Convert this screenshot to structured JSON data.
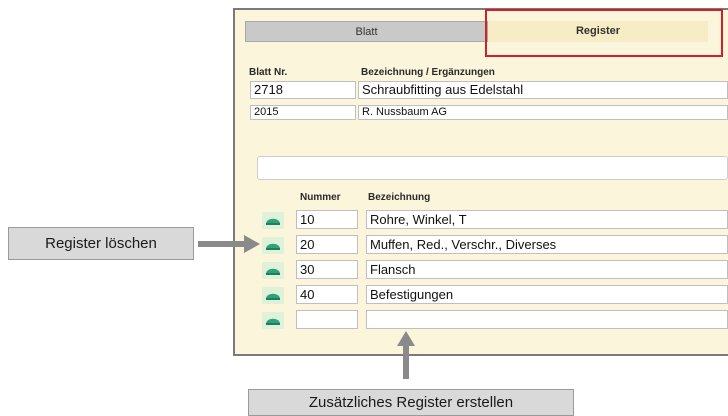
{
  "tabs": {
    "blatt": "Blatt",
    "register": "Register"
  },
  "header": {
    "blatt_nr_label": "Blatt Nr.",
    "bezeichnung_label": "Bezeichnung / Ergänzungen",
    "blatt_nr": "2718",
    "bezeichnung": "Schraubfitting aus Edelstahl",
    "year": "2015",
    "ergaenzung": "R. Nussbaum AG"
  },
  "register": {
    "nummer_label": "Nummer",
    "bezeichnung_label": "Bezeichnung",
    "rows": [
      {
        "nummer": "10",
        "bezeichnung": "Rohre, Winkel, T"
      },
      {
        "nummer": "20",
        "bezeichnung": "Muffen, Red., Verschr., Diverses"
      },
      {
        "nummer": "30",
        "bezeichnung": "Flansch"
      },
      {
        "nummer": "40",
        "bezeichnung": "Befestigungen"
      },
      {
        "nummer": "",
        "bezeichnung": ""
      }
    ]
  },
  "annotations": {
    "delete_register": "Register löschen",
    "add_register": "Zusätzliches Register erstellen"
  },
  "colors": {
    "panel_bg": "#fbf5db",
    "highlight": "#d02028",
    "icon_green": "#2ea37a",
    "arrow_gray": "#8a8a8a"
  },
  "icons": {
    "register_row": "register-delete-icon"
  }
}
